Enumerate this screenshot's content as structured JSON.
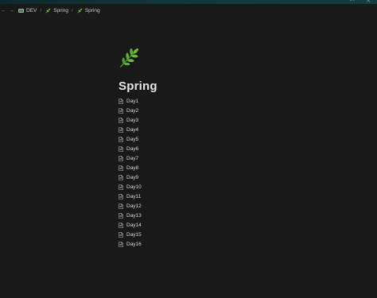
{
  "window": {
    "controls": [
      "⋯",
      "✕"
    ]
  },
  "breadcrumb": {
    "back_icon": "arrow-left-icon",
    "forward_icon": "arrow-right-icon",
    "items": [
      {
        "label": "DEV",
        "icon": "folder-icon"
      },
      {
        "label": "Spring",
        "icon": "leaf-icon"
      },
      {
        "label": "Spring",
        "icon": "leaf-icon"
      }
    ],
    "separator": "/"
  },
  "page": {
    "icon": "leaf-emoji-icon",
    "title": "Spring",
    "subpages": [
      "Day1",
      "Day2",
      "Day3",
      "Day4",
      "Day5",
      "Day6",
      "Day7",
      "Day8",
      "Day9",
      "Day10",
      "Day11",
      "Day12",
      "Day13",
      "Day14",
      "Day15",
      "Day16"
    ]
  },
  "colors": {
    "background": "#191919",
    "text": "#d4d4d4",
    "title": "#e6e6e6",
    "leaf_green": "#5fa833",
    "top_strip": "#12363b"
  }
}
